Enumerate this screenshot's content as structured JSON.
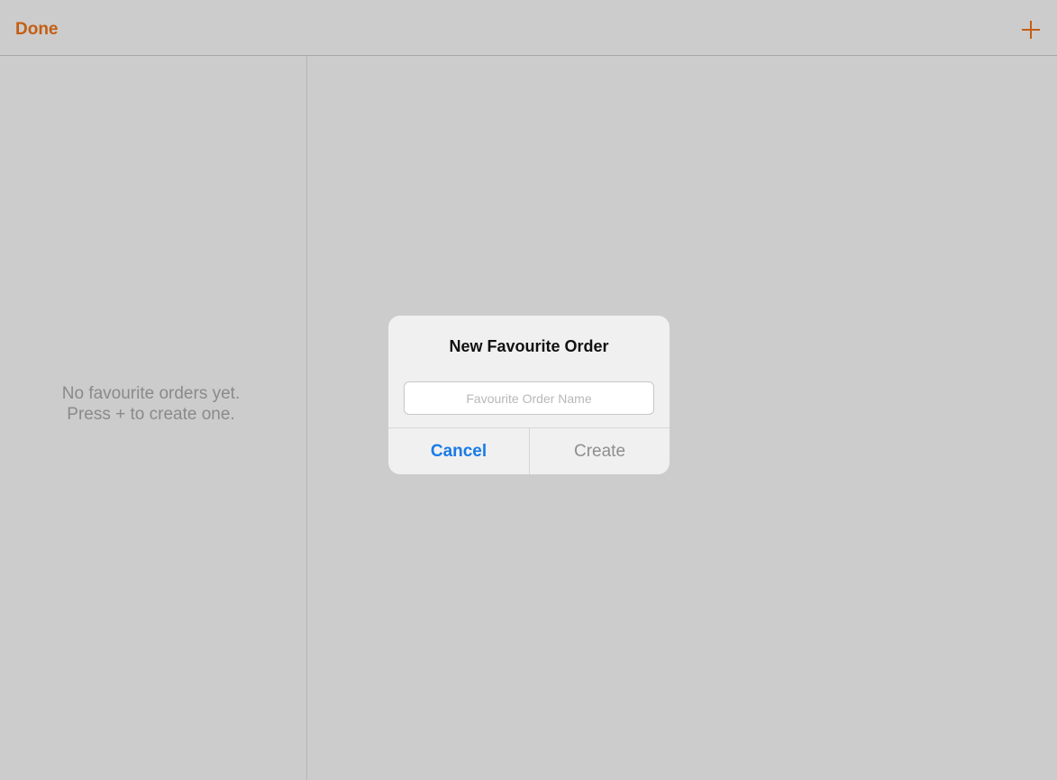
{
  "colors": {
    "accent": "#c45e12",
    "background": "#cccccc",
    "alert_background": "#f0f0f0",
    "cancel_blue": "#1a7be6",
    "disabled_gray": "#8e8e8e"
  },
  "navbar": {
    "done_label": "Done",
    "add_icon": "plus-icon"
  },
  "sidebar": {
    "empty_line1": "No favourite orders yet.",
    "empty_line2": "Press + to create one."
  },
  "alert": {
    "title": "New Favourite Order",
    "input_value": "",
    "input_placeholder": "Favourite Order Name",
    "cancel_label": "Cancel",
    "create_label": "Create"
  }
}
